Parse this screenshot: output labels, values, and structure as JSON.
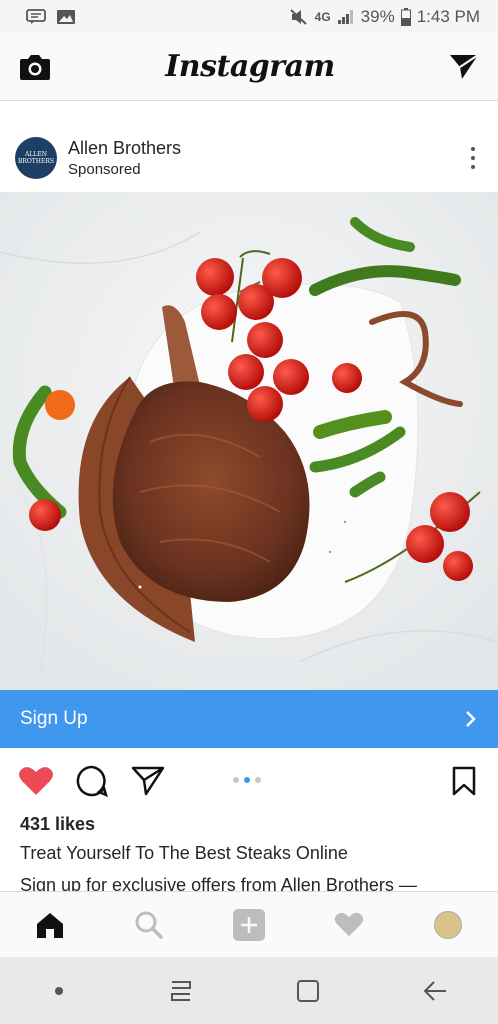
{
  "status_bar": {
    "network": "4G",
    "battery": "39%",
    "time": "1:43 PM"
  },
  "app_bar": {
    "title": "Instagram"
  },
  "post": {
    "author": "Allen Brothers",
    "label": "Sponsored",
    "avatar_text": "ALLEN BROTHERS",
    "cta_label": "Sign Up",
    "likes": "431 likes",
    "caption_line1": "Treat Yourself To The Best Steaks Online",
    "caption_line2": "Sign up for exclusive offers from Allen Brothers —",
    "carousel": {
      "count": 3,
      "active": 2
    }
  },
  "bottom_nav": [
    "home",
    "search",
    "add",
    "activity",
    "profile"
  ],
  "colors": {
    "cta": "#3f97ee",
    "like": "#ed4956",
    "brand": "#1d3f66"
  }
}
